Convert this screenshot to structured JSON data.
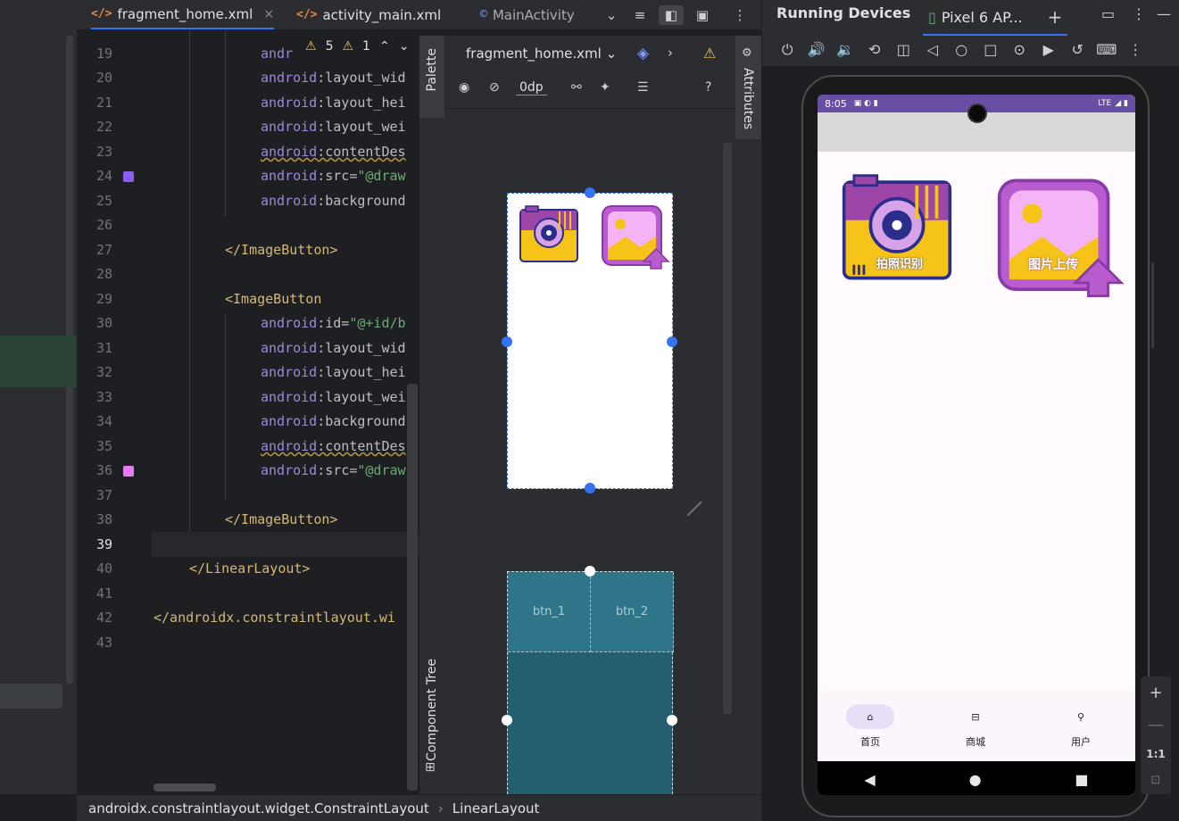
{
  "tabs": {
    "tab1": {
      "label": "fragment_home.xml",
      "icon": "</>",
      "close": "×"
    },
    "tab2": {
      "label": "activity_main.xml",
      "icon": "</>"
    },
    "tab3": {
      "label": "MainActivity",
      "icon": "©"
    }
  },
  "inspections": {
    "warnings": "5",
    "weak": "1"
  },
  "lines": [
    {
      "n": "19",
      "code": ""
    },
    {
      "n": "20",
      "code": ""
    },
    {
      "n": "21",
      "code": ""
    },
    {
      "n": "22",
      "code": ""
    },
    {
      "n": "23",
      "code": ""
    },
    {
      "n": "24",
      "code": ""
    },
    {
      "n": "25",
      "code": ""
    },
    {
      "n": "26",
      "code": ""
    },
    {
      "n": "27",
      "code": ""
    },
    {
      "n": "28",
      "code": ""
    },
    {
      "n": "29",
      "code": ""
    },
    {
      "n": "30",
      "code": ""
    },
    {
      "n": "31",
      "code": ""
    },
    {
      "n": "32",
      "code": ""
    },
    {
      "n": "33",
      "code": ""
    },
    {
      "n": "34",
      "code": ""
    },
    {
      "n": "35",
      "code": ""
    },
    {
      "n": "36",
      "code": ""
    },
    {
      "n": "37",
      "code": ""
    },
    {
      "n": "38",
      "code": ""
    },
    {
      "n": "39",
      "code": ""
    },
    {
      "n": "40",
      "code": ""
    },
    {
      "n": "41",
      "code": ""
    },
    {
      "n": "42",
      "code": ""
    },
    {
      "n": "43",
      "code": ""
    }
  ],
  "code": {
    "l19": "andr",
    "l20_ns": "android",
    "l20_attr": ":layout_wid",
    "l21_ns": "android",
    "l21_attr": ":layout_hei",
    "l22_ns": "android",
    "l22_attr": ":layout_wei",
    "l23_ns": "android",
    "l23_attr": ":contentDes",
    "l24_ns": "android",
    "l24_attr": ":src=",
    "l24_val": "\"@draw",
    "l25_ns": "android",
    "l25_attr": ":background",
    "l27": "</ImageButton>",
    "l29": "<ImageButton",
    "l30_ns": "android",
    "l30_attr": ":id=",
    "l30_val": "\"@+id/b",
    "l31_ns": "android",
    "l31_attr": ":layout_wid",
    "l32_ns": "android",
    "l32_attr": ":layout_hei",
    "l33_ns": "android",
    "l33_attr": ":layout_wei",
    "l34_ns": "android",
    "l34_attr": ":background",
    "l35_ns": "android",
    "l35_attr": ":contentDes",
    "l36_ns": "android",
    "l36_attr": ":src=",
    "l36_val": "\"@draw",
    "l38": "</ImageButton>",
    "l40": "</LinearLayout>",
    "l42": "</androidx.constraintlayout.wi"
  },
  "side": {
    "palette": "Palette",
    "component_tree": "Component Tree",
    "attributes": "Attributes"
  },
  "design": {
    "file": "fragment_home.xml",
    "dp": "0dp",
    "help": "?"
  },
  "blueprint": {
    "btn1": "btn_1",
    "btn2": "btn_2"
  },
  "breadcrumb": {
    "item1": "androidx.constraintlayout.widget.ConstraintLayout",
    "sep": "›",
    "item2": "LinearLayout"
  },
  "running": {
    "title": "Running Devices",
    "device_tab": "Pixel 6 AP..."
  },
  "phone": {
    "time": "8:05",
    "net": "LTE",
    "btn_camera_label": "拍照识别",
    "btn_upload_label": "图片上传",
    "nav": [
      {
        "label": "首页"
      },
      {
        "label": "商城"
      },
      {
        "label": "用户"
      }
    ]
  },
  "zoom": {
    "plus": "+",
    "minus": "—",
    "one": "1:1"
  },
  "colors": {
    "accent": "#3574f0",
    "status": "#6750a4",
    "nav_pill": "#e8def8"
  }
}
